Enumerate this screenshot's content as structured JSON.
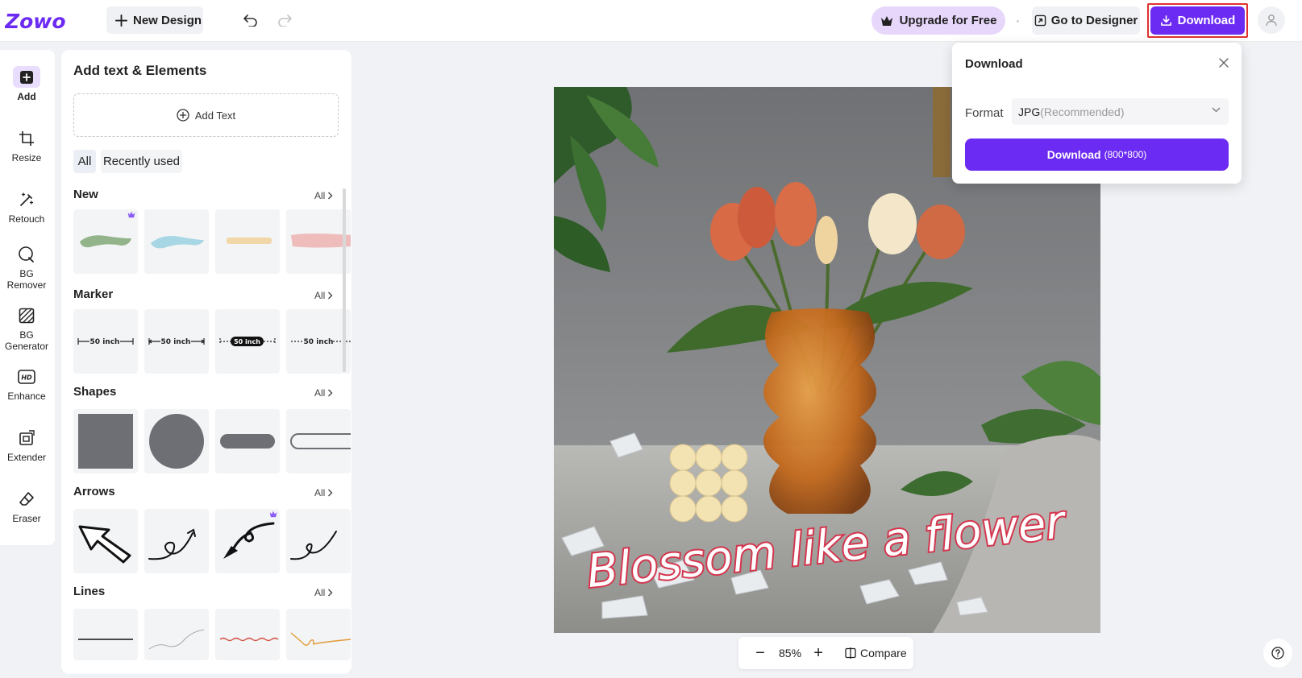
{
  "header": {
    "logo_text": "Zowo",
    "new_design_label": "New Design",
    "upgrade_label": "Upgrade for Free",
    "go_designer_label": "Go to Designer",
    "download_label": "Download"
  },
  "tools": [
    {
      "label": "Add",
      "icon": "plus-square-icon",
      "active": true
    },
    {
      "label": "Resize",
      "icon": "crop-icon",
      "active": false
    },
    {
      "label": "Retouch",
      "icon": "magic-wand-icon",
      "active": false
    },
    {
      "label": "BG Remover",
      "icon": "bg-remover-icon",
      "active": false
    },
    {
      "label": "BG Generator",
      "icon": "bg-generator-icon",
      "active": false
    },
    {
      "label": "Enhance",
      "icon": "hd-icon",
      "active": false
    },
    {
      "label": "Extender",
      "icon": "extender-icon",
      "active": false
    },
    {
      "label": "Eraser",
      "icon": "eraser-icon",
      "active": false
    }
  ],
  "panel": {
    "title": "Add text & Elements",
    "add_text_label": "Add Text",
    "filter_all": "All",
    "filter_recent": "Recently used",
    "sections": [
      {
        "title": "New",
        "all_label": "All"
      },
      {
        "title": "Marker",
        "all_label": "All"
      },
      {
        "title": "Shapes",
        "all_label": "All"
      },
      {
        "title": "Arrows",
        "all_label": "All"
      },
      {
        "title": "Lines",
        "all_label": "All"
      }
    ],
    "marker_labels": [
      "50 inch",
      "50 inch",
      "50 inch",
      "50 inch"
    ]
  },
  "canvas": {
    "image_caption": "Blossom like a flower",
    "zoom_level": "85%",
    "zoom_minus": "−",
    "zoom_plus": "+",
    "compare_label": "Compare"
  },
  "download_popup": {
    "title": "Download",
    "format_label": "Format",
    "format_value": "JPG",
    "format_hint": "(Recommended)",
    "button_label": "Download",
    "button_dims": "(800*800)"
  },
  "colors": {
    "accent": "#6c2bf2",
    "upgrade_bg": "#e7d7fb",
    "highlight_border": "#e03131"
  }
}
